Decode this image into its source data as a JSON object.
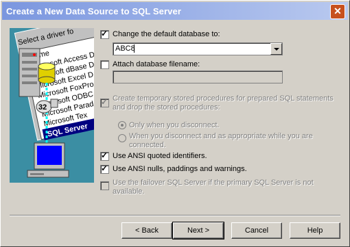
{
  "window": {
    "title": "Create a New Data Source to SQL Server",
    "close_glyph": "✕"
  },
  "illustration": {
    "list_header": "Select a driver fo",
    "column_label": "Name",
    "driver_items": [
      "Microsoft Access D",
      "Microsoft dBase D",
      "Microsoft Excel D",
      "Microsoft FoxPro",
      "Microsoft ODBC",
      "Microsoft Parad",
      "Microsoft Tex",
      "SQL Server"
    ],
    "badge": "32"
  },
  "options": {
    "change_default_db": {
      "label": "Change the default database to:",
      "checked": true
    },
    "database_value": "ABC8",
    "attach_db": {
      "label": "Attach database filename:",
      "checked": false
    },
    "attach_value": "",
    "temp_procs": {
      "line1": "Create temporary stored procedures for prepared SQL statements",
      "line2": "and drop the stored procedures:",
      "checked": true
    },
    "radio_only_disconnect": "Only when you disconnect.",
    "radio_disconnect_and": {
      "line1": "When you disconnect and as appropriate while you are",
      "line2": "connected."
    },
    "ansi_quoted": {
      "label": "Use ANSI quoted identifiers.",
      "checked": true
    },
    "ansi_nulls": {
      "label": "Use ANSI nulls, paddings and warnings.",
      "checked": true
    },
    "failover": {
      "line1": "Use the failover SQL Server if the primary SQL Server is not",
      "line2": "available.",
      "checked": false
    }
  },
  "buttons": {
    "back": "< Back",
    "next": "Next >",
    "cancel": "Cancel",
    "help": "Help"
  }
}
